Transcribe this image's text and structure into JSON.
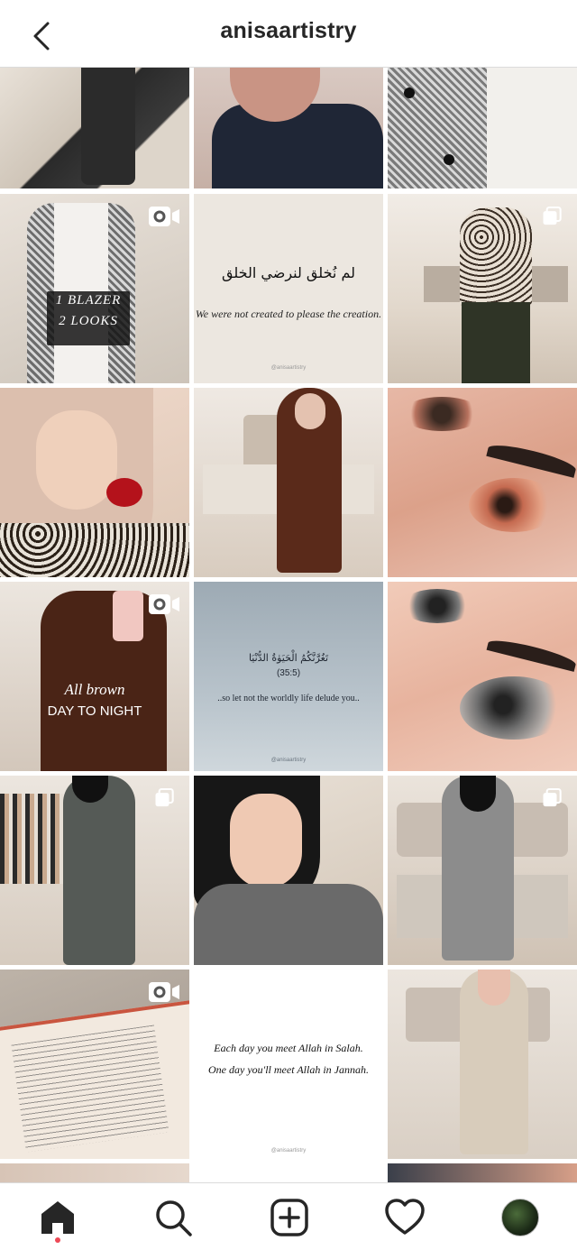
{
  "header": {
    "username": "anisaartistry",
    "back_icon": "chevron-left-icon"
  },
  "grid": {
    "quote1_arabic": "لم نُخلق لنرضي الخلق",
    "quote1_english": "We were not created to please the creation.",
    "blazer_line1": "1 BLAZER",
    "blazer_line2": "2 LOOKS",
    "brown_line1": "All brown",
    "brown_line2": "DAY TO NIGHT",
    "quote2_arabic": "تَغُرَّنَّكُمُ الْحَيَوٰةُ الدُّنْيَا",
    "quote2_ref": "(35:5)",
    "quote2_english": "..so let not the worldly life delude you..",
    "quote3_line1": "Each day you meet Allah in Salah.",
    "quote3_line2": "One day you'll meet Allah in Jannah.",
    "watermark": "@anisaartistry"
  },
  "bottom_nav": {
    "items": [
      "home-icon",
      "search-icon",
      "add-post-icon",
      "activity-heart-icon",
      "profile-avatar"
    ],
    "active": "home"
  },
  "colors": {
    "accent_dot": "#ed4956",
    "divider": "#dbdbdb",
    "text": "#262626"
  }
}
